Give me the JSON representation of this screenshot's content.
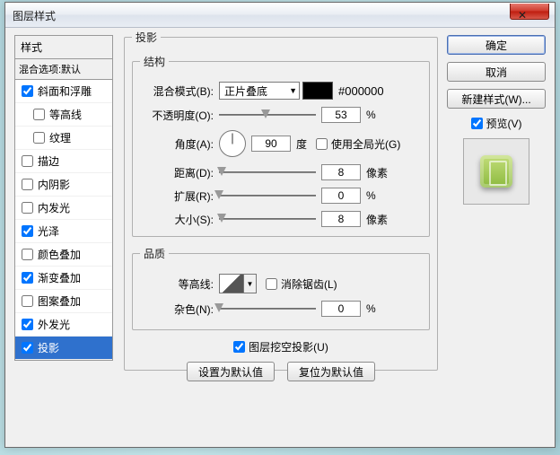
{
  "title": "图层样式",
  "close_glyph": "✕",
  "styles": {
    "header": "样式",
    "sub": "混合选项:默认",
    "items": [
      {
        "label": "斜面和浮雕",
        "checked": true,
        "indent": false
      },
      {
        "label": "等高线",
        "checked": false,
        "indent": true
      },
      {
        "label": "纹理",
        "checked": false,
        "indent": true
      },
      {
        "label": "描边",
        "checked": false,
        "indent": false
      },
      {
        "label": "内阴影",
        "checked": false,
        "indent": false
      },
      {
        "label": "内发光",
        "checked": false,
        "indent": false
      },
      {
        "label": "光泽",
        "checked": true,
        "indent": false
      },
      {
        "label": "颜色叠加",
        "checked": false,
        "indent": false
      },
      {
        "label": "渐变叠加",
        "checked": true,
        "indent": false
      },
      {
        "label": "图案叠加",
        "checked": false,
        "indent": false
      },
      {
        "label": "外发光",
        "checked": true,
        "indent": false
      },
      {
        "label": "投影",
        "checked": true,
        "indent": false,
        "selected": true
      }
    ]
  },
  "main": {
    "title": "投影",
    "structure": {
      "title": "结构",
      "blend_label": "混合模式(B):",
      "blend_value": "正片叠底",
      "color_hex": "#000000",
      "opacity_label": "不透明度(O):",
      "opacity_value": "53",
      "opacity_unit": "%",
      "opacity_thumb_pct": 53,
      "angle_label": "角度(A):",
      "angle_value": "90",
      "angle_unit": "度",
      "global_light": "使用全局光(G)",
      "distance_label": "距离(D):",
      "distance_value": "8",
      "distance_unit": "像素",
      "distance_thumb_pct": 3,
      "spread_label": "扩展(R):",
      "spread_value": "0",
      "spread_unit": "%",
      "spread_thumb_pct": 0,
      "size_label": "大小(S):",
      "size_value": "8",
      "size_unit": "像素",
      "size_thumb_pct": 3
    },
    "quality": {
      "title": "品质",
      "contour_label": "等高线:",
      "antialias": "消除锯齿(L)",
      "noise_label": "杂色(N):",
      "noise_value": "0",
      "noise_unit": "%",
      "noise_thumb_pct": 0
    },
    "knockout": "图层挖空投影(U)",
    "set_default": "设置为默认值",
    "reset_default": "复位为默认值"
  },
  "right": {
    "ok": "确定",
    "cancel": "取消",
    "new_style": "新建样式(W)...",
    "preview": "预览(V)"
  }
}
